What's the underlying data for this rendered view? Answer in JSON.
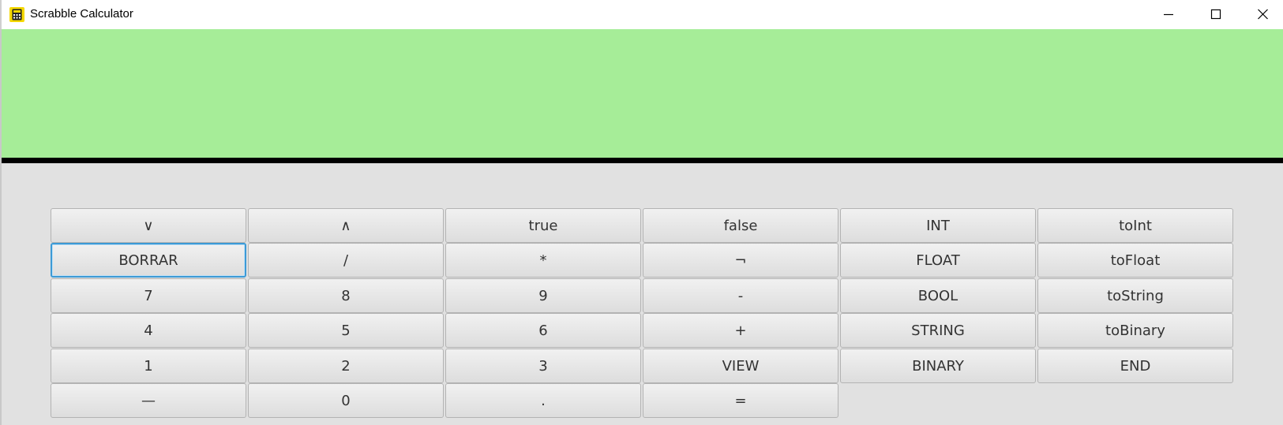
{
  "window": {
    "title": "Scrabble Calculator",
    "icon": "calculator-icon",
    "controls": [
      "minimize-icon",
      "maximize-icon",
      "close-icon"
    ]
  },
  "display": {
    "value": "",
    "background": "#a6ed98"
  },
  "keypad": {
    "rows": [
      [
        "∨",
        "∧",
        "true",
        "false",
        "INT",
        "toInt"
      ],
      [
        "BORRAR",
        "/",
        "*",
        "¬",
        "FLOAT",
        "toFloat"
      ],
      [
        "7",
        "8",
        "9",
        "-",
        "BOOL",
        "toString"
      ],
      [
        "4",
        "5",
        "6",
        "+",
        "STRING",
        "toBinary"
      ],
      [
        "1",
        "2",
        "3",
        "VIEW",
        "BINARY",
        "END"
      ],
      [
        "—",
        "0",
        ".",
        "="
      ]
    ],
    "focused_key": "BORRAR"
  }
}
